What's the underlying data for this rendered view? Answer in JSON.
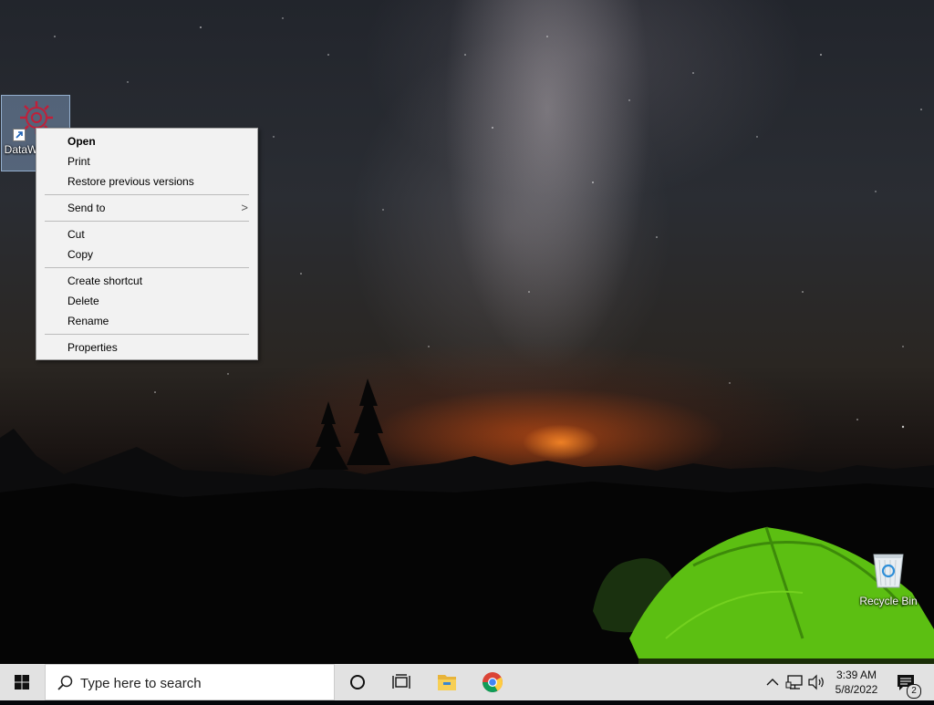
{
  "desktop": {
    "icons": [
      {
        "label": "DataWorks Collaboration",
        "visible_label": "DataW… o…",
        "icon": "dataworks-app-icon"
      },
      {
        "label": "Recycle Bin",
        "icon": "recycle-bin-icon"
      }
    ]
  },
  "context_menu": {
    "items": [
      {
        "label": "Open",
        "bold": true
      },
      {
        "label": "Print"
      },
      {
        "label": "Restore previous versions"
      },
      {
        "label": "Send to",
        "has_submenu": true
      },
      {
        "label": "Cut"
      },
      {
        "label": "Copy"
      },
      {
        "label": "Create shortcut"
      },
      {
        "label": "Delete"
      },
      {
        "label": "Rename"
      },
      {
        "label": "Properties"
      }
    ],
    "submenu_arrow": ">"
  },
  "taskbar": {
    "start_icon": "windows-logo-icon",
    "search": {
      "placeholder": "Type here to search",
      "value": ""
    },
    "pinned": [
      {
        "name": "Cortana",
        "icon": "cortana-circle-icon"
      },
      {
        "name": "Task View",
        "icon": "task-view-icon"
      },
      {
        "name": "File Explorer",
        "icon": "file-explorer-icon"
      },
      {
        "name": "Google Chrome",
        "icon": "chrome-icon"
      }
    ],
    "tray": {
      "icons": [
        "chevron-up-icon",
        "network-icon",
        "volume-icon"
      ],
      "time": "3:39 AM",
      "date": "5/8/2022",
      "notification_count": "2"
    }
  }
}
